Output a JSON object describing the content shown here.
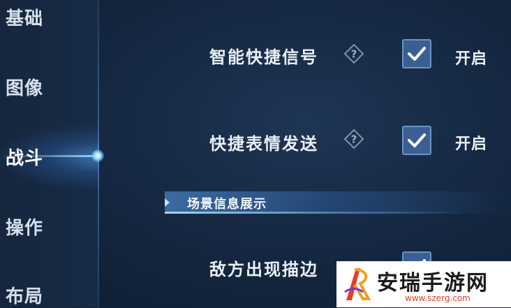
{
  "sidebar": {
    "items": [
      {
        "label": "基础"
      },
      {
        "label": "图像"
      },
      {
        "label": "战斗",
        "active": true
      },
      {
        "label": "操作"
      },
      {
        "label": "布局"
      }
    ]
  },
  "settings": [
    {
      "label": "智能快捷信号",
      "checked": true,
      "state": "开启"
    },
    {
      "label": "快捷表情发送",
      "checked": true,
      "state": "开启"
    }
  ],
  "section": {
    "title": "场景信息展示"
  },
  "partial_row": {
    "label": "敌方出现描边",
    "checked": true
  },
  "watermark": {
    "text": "安瑞手游网",
    "url": "www.szerg.com"
  },
  "colors": {
    "checkbox_fill": "#3b5f92",
    "accent_glow": "#9fe0ff",
    "watermark_red": "#e0412e"
  }
}
